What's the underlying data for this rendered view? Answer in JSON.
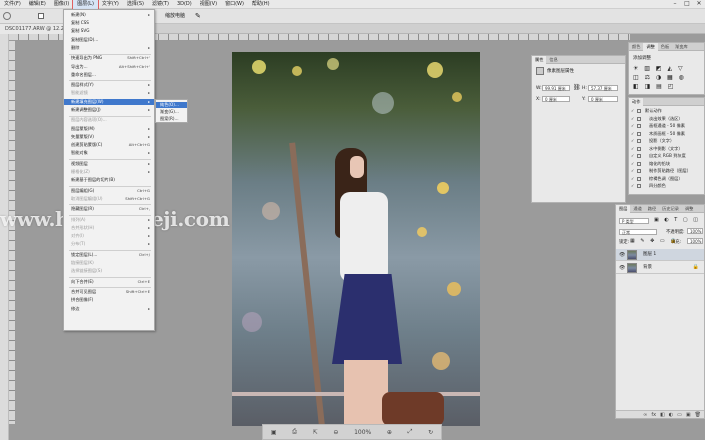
{
  "menubar": {
    "items": [
      "文件(F)",
      "编辑(E)",
      "图像(I)",
      "图层(L)",
      "文字(Y)",
      "选择(S)",
      "滤镜(T)",
      "3D(D)",
      "视图(V)",
      "窗口(W)",
      "帮助(H)"
    ],
    "active_index": 3,
    "window_controls": [
      "–",
      "□",
      "✕"
    ]
  },
  "optionsbar": {
    "label": "缩放电脑"
  },
  "document_tab": {
    "title": "DSC01177.ARW @ 12.2% (图层1, RGB/8) *"
  },
  "layer_menu": {
    "items": [
      {
        "label": "新建(N)",
        "shortcut": "",
        "state": "normal",
        "arrow": true
      },
      {
        "label": "复制 CSS",
        "shortcut": "",
        "state": "normal",
        "arrow": false
      },
      {
        "label": "复制 SVG",
        "shortcut": "",
        "state": "normal",
        "arrow": false
      },
      {
        "label": "复制图层(D)...",
        "shortcut": "",
        "state": "normal",
        "arrow": false
      },
      {
        "label": "删除",
        "shortcut": "",
        "state": "normal",
        "arrow": true
      },
      {
        "label": "快速导出为 PNG",
        "shortcut": "Shift+Ctrl+'",
        "state": "normal",
        "arrow": false
      },
      {
        "label": "导出为...",
        "shortcut": "Alt+Shift+Ctrl+'",
        "state": "normal",
        "arrow": false
      },
      {
        "label": "重命名图层...",
        "shortcut": "",
        "state": "normal",
        "arrow": false
      },
      {
        "label": "图层样式(Y)",
        "shortcut": "",
        "state": "normal",
        "arrow": true
      },
      {
        "label": "智能滤镜",
        "shortcut": "",
        "state": "disabled",
        "arrow": true
      },
      {
        "label": "新建填充图层(W)",
        "shortcut": "",
        "state": "highlight",
        "arrow": true
      },
      {
        "label": "新建调整图层(J)",
        "shortcut": "",
        "state": "normal",
        "arrow": true
      },
      {
        "label": "图层内容选项(O)...",
        "shortcut": "",
        "state": "disabled",
        "arrow": false
      },
      {
        "label": "图层蒙版(M)",
        "shortcut": "",
        "state": "normal",
        "arrow": true
      },
      {
        "label": "矢量蒙版(V)",
        "shortcut": "",
        "state": "normal",
        "arrow": true
      },
      {
        "label": "创建剪贴蒙版(C)",
        "shortcut": "Alt+Ctrl+G",
        "state": "normal",
        "arrow": false
      },
      {
        "label": "智能对象",
        "shortcut": "",
        "state": "normal",
        "arrow": true
      },
      {
        "label": "视频图层",
        "shortcut": "",
        "state": "normal",
        "arrow": true
      },
      {
        "label": "栅格化(Z)",
        "shortcut": "",
        "state": "disabled",
        "arrow": true
      },
      {
        "label": "新建基于图层的切片(B)",
        "shortcut": "",
        "state": "normal",
        "arrow": false
      },
      {
        "label": "图层编组(G)",
        "shortcut": "Ctrl+G",
        "state": "normal",
        "arrow": false
      },
      {
        "label": "取消图层编组(U)",
        "shortcut": "Shift+Ctrl+G",
        "state": "disabled",
        "arrow": false
      },
      {
        "label": "隐藏图层(R)",
        "shortcut": "Ctrl+,",
        "state": "normal",
        "arrow": false
      },
      {
        "label": "排列(A)",
        "shortcut": "",
        "state": "disabled",
        "arrow": true
      },
      {
        "label": "合并形状(H)",
        "shortcut": "",
        "state": "disabled",
        "arrow": true
      },
      {
        "label": "对齐(I)",
        "shortcut": "",
        "state": "disabled",
        "arrow": true
      },
      {
        "label": "分布(T)",
        "shortcut": "",
        "state": "disabled",
        "arrow": true
      },
      {
        "label": "锁定图层(L)...",
        "shortcut": "Ctrl+/",
        "state": "normal",
        "arrow": false
      },
      {
        "label": "链接图层(K)",
        "shortcut": "",
        "state": "disabled",
        "arrow": false
      },
      {
        "label": "选择链接图层(S)",
        "shortcut": "",
        "state": "disabled",
        "arrow": false
      },
      {
        "label": "向下合并(E)",
        "shortcut": "Ctrl+E",
        "state": "normal",
        "arrow": false
      },
      {
        "label": "合并可见图层",
        "shortcut": "Shift+Ctrl+E",
        "state": "normal",
        "arrow": false
      },
      {
        "label": "拼合图像(F)",
        "shortcut": "",
        "state": "normal",
        "arrow": false
      },
      {
        "label": "修边",
        "shortcut": "",
        "state": "normal",
        "arrow": true
      }
    ]
  },
  "fill_submenu": {
    "items": [
      "纯色(O)...",
      "渐变(G)...",
      "图案(R)..."
    ],
    "highlight_index": 0
  },
  "properties_panel": {
    "tabs": [
      "属性",
      "信息"
    ],
    "title": "像素图层属性",
    "w_label": "W:",
    "w_value": "99.91 厘米",
    "h_label": "H:",
    "h_value": "57.37 厘米",
    "x_label": "X:",
    "x_value": "0 厘米",
    "y_label": "Y:",
    "y_value": "0 厘米"
  },
  "adjust_panel": {
    "tabs": [
      "颜色",
      "调整",
      "色板",
      "渐变库"
    ],
    "label": "添加调整"
  },
  "actions_panel": {
    "tab": "动作",
    "rows": [
      "默认动作",
      "淡出效果（选区）",
      "画框通道 - 50 像素",
      "木质画框 - 50 像素",
      "投影（文字）",
      "水中倒影（文字）",
      "自定义 RGB 到灰度",
      "熔化的铅块",
      "制作剪贴路径（图层）",
      "棕褐色调（图层）",
      "四分颜色"
    ]
  },
  "layers_panel": {
    "tabs": [
      "图层",
      "通道",
      "路径",
      "历史记录",
      "调整"
    ],
    "kind": "P 类型",
    "mode": "正常",
    "opacity_label": "不透明度:",
    "opacity_value": "100%",
    "lock_label": "锁定:",
    "fill_label": "填充:",
    "fill_value": "100%",
    "layers": [
      {
        "name": "图层 1",
        "locked": false
      },
      {
        "name": "背景",
        "locked": true
      }
    ],
    "bottom_icons": [
      "∞",
      "fx",
      "◧",
      "◐",
      "▭",
      "▣",
      "🗑"
    ]
  },
  "statusbar": {
    "zoom": "100%"
  },
  "watermark": {
    "text": "www.hnzzmsheji.com"
  },
  "colors": {
    "highlight": "#3f78cc",
    "panel": "#e9e9e9",
    "canvas": "#9b9b9b"
  }
}
